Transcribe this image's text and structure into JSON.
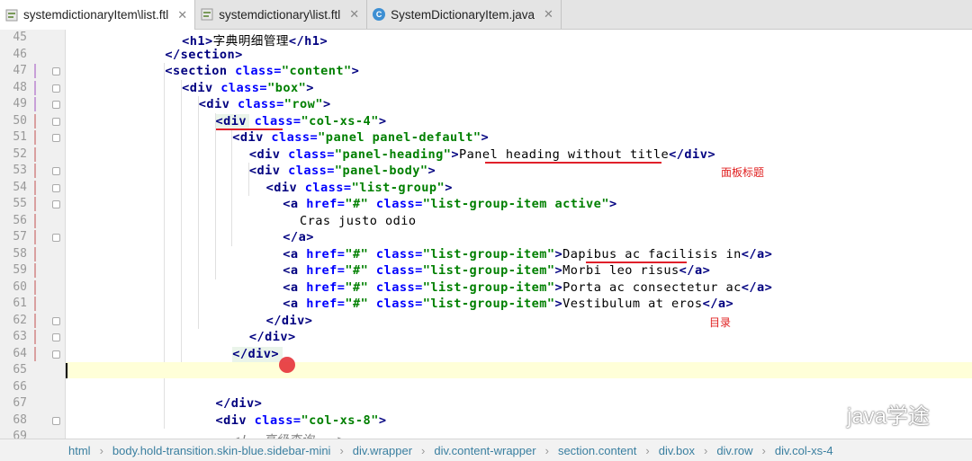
{
  "tabs": [
    {
      "label": "systemdictionaryItem\\list.ftl",
      "active": true,
      "icon": "ftl-file-icon"
    },
    {
      "label": "systemdictionary\\list.ftl",
      "active": false,
      "icon": "ftl-file-icon"
    },
    {
      "label": "SystemDictionaryItem.java",
      "active": false,
      "icon": "java-class-icon"
    }
  ],
  "lines": [
    {
      "n": "45",
      "indent": 6,
      "parts": [
        [
          "tg",
          "<h1>"
        ],
        [
          "tx",
          "字典明细管理"
        ],
        [
          "tg",
          "</h1>"
        ]
      ]
    },
    {
      "n": "46",
      "indent": 4,
      "parts": [
        [
          "tg",
          "</section>"
        ]
      ]
    },
    {
      "n": "47",
      "indent": 4,
      "parts": [
        [
          "tg",
          "<section "
        ],
        [
          "at",
          "class="
        ],
        [
          "vl",
          "\"content\""
        ],
        [
          "tg",
          ">"
        ]
      ]
    },
    {
      "n": "48",
      "indent": 6,
      "parts": [
        [
          "tg",
          "<div "
        ],
        [
          "at",
          "class="
        ],
        [
          "vl",
          "\"box\""
        ],
        [
          "tg",
          ">"
        ]
      ]
    },
    {
      "n": "49",
      "indent": 8,
      "parts": [
        [
          "tg",
          "<div "
        ],
        [
          "at",
          "class="
        ],
        [
          "vl",
          "\"row\""
        ],
        [
          "tg",
          ">"
        ]
      ]
    },
    {
      "n": "50",
      "indent": 10,
      "parts": [
        [
          "tg",
          "<div "
        ],
        [
          "at",
          "class="
        ],
        [
          "vl",
          "\"col-xs-4\""
        ],
        [
          "tg",
          ">"
        ]
      ]
    },
    {
      "n": "51",
      "indent": 12,
      "parts": [
        [
          "tg",
          "<div "
        ],
        [
          "at",
          "class="
        ],
        [
          "vl",
          "\"panel panel-default\""
        ],
        [
          "tg",
          ">"
        ]
      ]
    },
    {
      "n": "52",
      "indent": 14,
      "parts": [
        [
          "tg",
          "<div "
        ],
        [
          "at",
          "class="
        ],
        [
          "vl",
          "\"panel-heading\""
        ],
        [
          "tg",
          ">"
        ],
        [
          "tx",
          "Panel heading without title"
        ],
        [
          "tg",
          "</div>"
        ]
      ]
    },
    {
      "n": "53",
      "indent": 14,
      "parts": [
        [
          "tg",
          "<div "
        ],
        [
          "at",
          "class="
        ],
        [
          "vl",
          "\"panel-body\""
        ],
        [
          "tg",
          ">"
        ]
      ]
    },
    {
      "n": "54",
      "indent": 16,
      "parts": [
        [
          "tg",
          "<div "
        ],
        [
          "at",
          "class="
        ],
        [
          "vl",
          "\"list-group\""
        ],
        [
          "tg",
          ">"
        ]
      ]
    },
    {
      "n": "55",
      "indent": 18,
      "parts": [
        [
          "tg",
          "<a "
        ],
        [
          "at",
          "href="
        ],
        [
          "vl",
          "\"#\" "
        ],
        [
          "at",
          "class="
        ],
        [
          "vl",
          "\"list-group-item active\""
        ],
        [
          "tg",
          ">"
        ]
      ]
    },
    {
      "n": "56",
      "indent": 20,
      "parts": [
        [
          "tx",
          "Cras justo odio"
        ]
      ]
    },
    {
      "n": "57",
      "indent": 18,
      "parts": [
        [
          "tg",
          "</a>"
        ]
      ]
    },
    {
      "n": "58",
      "indent": 18,
      "parts": [
        [
          "tg",
          "<a "
        ],
        [
          "at",
          "href="
        ],
        [
          "vl",
          "\"#\" "
        ],
        [
          "at",
          "class="
        ],
        [
          "vl",
          "\"list-group-item\""
        ],
        [
          "tg",
          ">"
        ],
        [
          "tx",
          "Dapibus ac facilisis in"
        ],
        [
          "tg",
          "</a>"
        ]
      ]
    },
    {
      "n": "59",
      "indent": 18,
      "parts": [
        [
          "tg",
          "<a "
        ],
        [
          "at",
          "href="
        ],
        [
          "vl",
          "\"#\" "
        ],
        [
          "at",
          "class="
        ],
        [
          "vl",
          "\"list-group-item\""
        ],
        [
          "tg",
          ">"
        ],
        [
          "tx",
          "Morbi leo risus"
        ],
        [
          "tg",
          "</a>"
        ]
      ]
    },
    {
      "n": "60",
      "indent": 18,
      "parts": [
        [
          "tg",
          "<a "
        ],
        [
          "at",
          "href="
        ],
        [
          "vl",
          "\"#\" "
        ],
        [
          "at",
          "class="
        ],
        [
          "vl",
          "\"list-group-item\""
        ],
        [
          "tg",
          ">"
        ],
        [
          "tx",
          "Porta ac consectetur ac"
        ],
        [
          "tg",
          "</a>"
        ]
      ]
    },
    {
      "n": "61",
      "indent": 18,
      "parts": [
        [
          "tg",
          "<a "
        ],
        [
          "at",
          "href="
        ],
        [
          "vl",
          "\"#\" "
        ],
        [
          "at",
          "class="
        ],
        [
          "vl",
          "\"list-group-item\""
        ],
        [
          "tg",
          ">"
        ],
        [
          "tx",
          "Vestibulum at eros"
        ],
        [
          "tg",
          "</a>"
        ]
      ]
    },
    {
      "n": "62",
      "indent": 16,
      "parts": [
        [
          "tg",
          "</div>"
        ]
      ]
    },
    {
      "n": "63",
      "indent": 14,
      "parts": [
        [
          "tg",
          "</div>"
        ]
      ]
    },
    {
      "n": "64",
      "indent": 12,
      "parts": [
        [
          "tg",
          "</div>"
        ]
      ]
    },
    {
      "n": "65",
      "indent": 0,
      "parts": []
    },
    {
      "n": "66",
      "indent": 0,
      "parts": []
    },
    {
      "n": "67",
      "indent": 10,
      "parts": [
        [
          "tg",
          "</div>"
        ]
      ]
    },
    {
      "n": "68",
      "indent": 10,
      "parts": [
        [
          "tg",
          "<div "
        ],
        [
          "at",
          "class="
        ],
        [
          "vl",
          "\"col-xs-8\""
        ],
        [
          "tg",
          ">"
        ]
      ]
    },
    {
      "n": "69",
      "indent": 12,
      "parts": [
        [
          "cm",
          "<!--高级查询--->"
        ]
      ]
    }
  ],
  "annotations": {
    "panel_heading_note": "面板标题",
    "list_note": "目录"
  },
  "breadcrumb": [
    "html",
    "body.hold-transition.skin-blue.sidebar-mini",
    "div.wrapper",
    "div.content-wrapper",
    "section.content",
    "div.box",
    "div.row",
    "div.col-xs-4"
  ],
  "watermark": "java学途",
  "colors": {
    "tag": "#000080",
    "attr": "#0000ff",
    "value": "#008000",
    "annotation": "#e02020"
  }
}
